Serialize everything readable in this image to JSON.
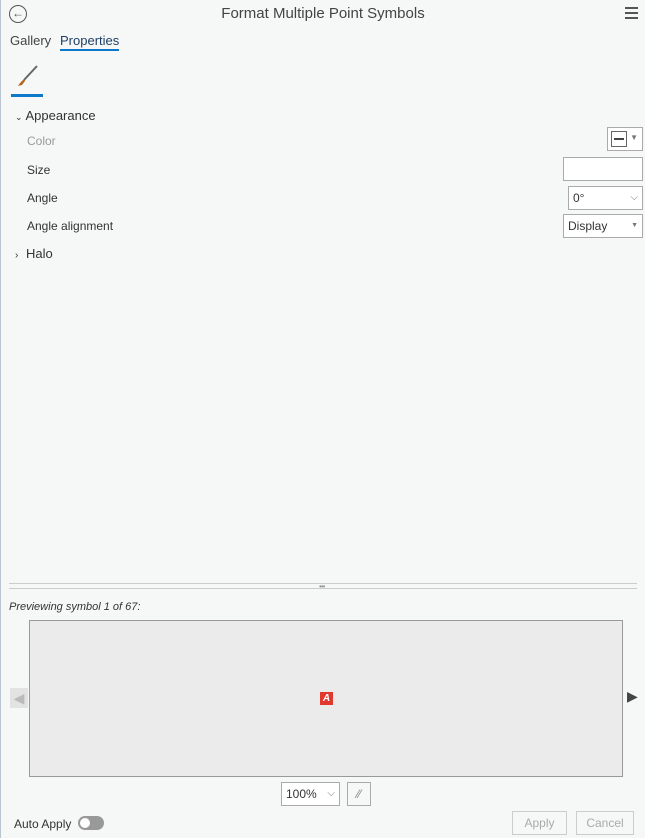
{
  "header": {
    "title": "Format Multiple Point Symbols"
  },
  "tabs": [
    {
      "label": "Gallery"
    },
    {
      "label": "Properties"
    }
  ],
  "appearance": {
    "title": "Appearance",
    "color_label": "Color",
    "size_label": "Size",
    "size_value": "",
    "angle_label": "Angle",
    "angle_value": "0°",
    "alignment_label": "Angle alignment",
    "alignment_value": "Display"
  },
  "halo": {
    "title": "Halo"
  },
  "preview": {
    "caption": "Previewing symbol 1 of 67:",
    "zoom": "100%",
    "symbol_color": "#e03a2f"
  },
  "footer": {
    "auto_apply": "Auto Apply",
    "apply": "Apply",
    "cancel": "Cancel"
  }
}
